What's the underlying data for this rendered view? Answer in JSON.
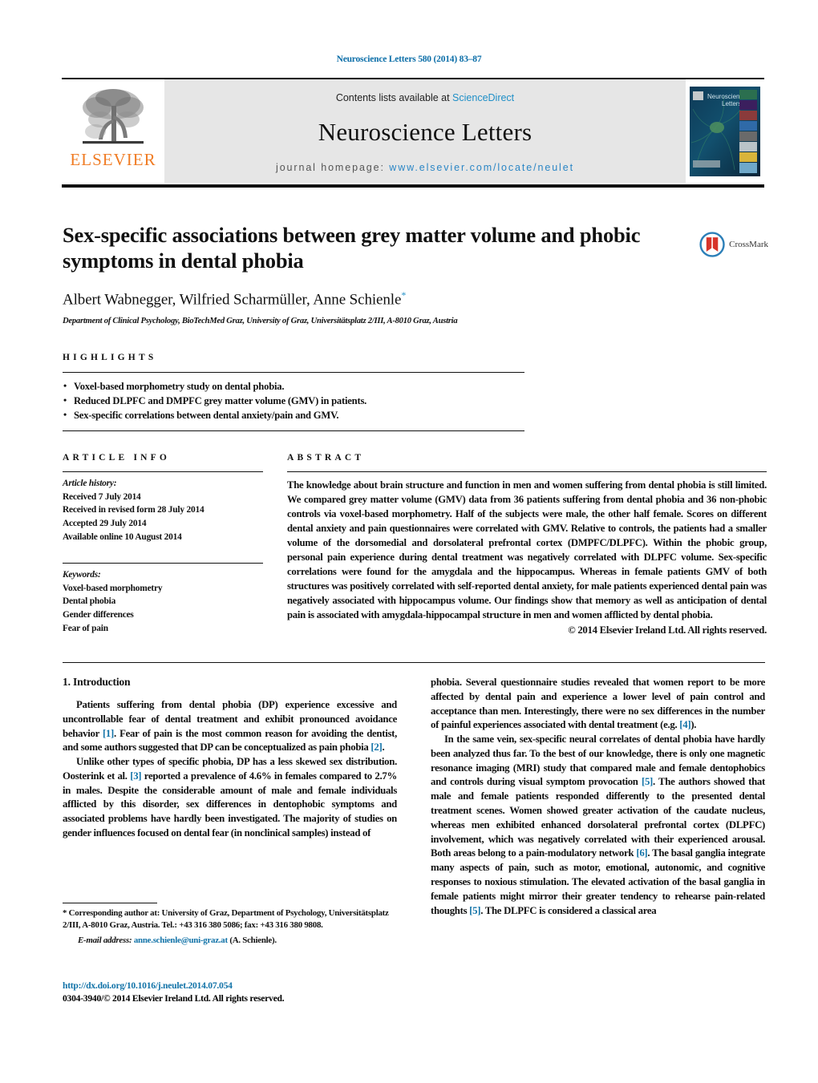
{
  "running_head": "Neuroscience Letters 580 (2014) 83–87",
  "masthead": {
    "contents_prefix": "Contents lists available at ",
    "sciencedirect": "ScienceDirect",
    "journal_title": "Neuroscience Letters",
    "homepage_label": "journal homepage:",
    "homepage_url": "www.elsevier.com/locate/neulet",
    "publisher_wordmark": "ELSEVIER",
    "publisher_color": "#f07c24",
    "link_color": "#1f8fc7",
    "cover_title_line1": "Neuroscience",
    "cover_title_line2": "Letters"
  },
  "article": {
    "title": "Sex-specific associations between grey matter volume and phobic symptoms in dental phobia",
    "authors": "Albert Wabnegger, Wilfried Scharmüller, Anne Schienle",
    "corresponding_marker": "*",
    "affiliation": "Department of Clinical Psychology, BioTechMed Graz, University of Graz, Universitätsplatz 2/III, A-8010 Graz, Austria",
    "crossmark_label": "CrossMark"
  },
  "highlights": {
    "heading": "HIGHLIGHTS",
    "items": [
      "Voxel-based morphometry study on dental phobia.",
      "Reduced DLPFC and DMPFC grey matter volume (GMV) in patients.",
      "Sex-specific correlations between dental anxiety/pain and GMV."
    ]
  },
  "article_info": {
    "heading": "ARTICLE INFO",
    "history_label": "Article history:",
    "history": [
      "Received 7 July 2014",
      "Received in revised form 28 July 2014",
      "Accepted 29 July 2014",
      "Available online 10 August 2014"
    ],
    "keywords_label": "Keywords:",
    "keywords": [
      "Voxel-based morphometry",
      "Dental phobia",
      "Gender differences",
      "Fear of pain"
    ]
  },
  "abstract": {
    "heading": "ABSTRACT",
    "text": "The knowledge about brain structure and function in men and women suffering from dental phobia is still limited. We compared grey matter volume (GMV) data from 36 patients suffering from dental phobia and 36 non-phobic controls via voxel-based morphometry. Half of the subjects were male, the other half female. Scores on different dental anxiety and pain questionnaires were correlated with GMV. Relative to controls, the patients had a smaller volume of the dorsomedial and dorsolateral prefrontal cortex (DMPFC/DLPFC). Within the phobic group, personal pain experience during dental treatment was negatively correlated with DLPFC volume. Sex-specific correlations were found for the amygdala and the hippocampus. Whereas in female patients GMV of both structures was positively correlated with self-reported dental anxiety, for male patients experienced dental pain was negatively associated with hippocampus volume. Our findings show that memory as well as anticipation of dental pain is associated with amygdala-hippocampal structure in men and women afflicted by dental phobia.",
    "copyright": "© 2014 Elsevier Ireland Ltd. All rights reserved."
  },
  "body": {
    "section_heading": "1.  Introduction",
    "left_paragraphs": [
      "Patients suffering from dental phobia (DP) experience excessive and uncontrollable fear of dental treatment and exhibit pronounced avoidance behavior [1]. Fear of pain is the most common reason for avoiding the dentist, and some authors suggested that DP can be conceptualized as pain phobia [2].",
      "Unlike other types of specific phobia, DP has a less skewed sex distribution. Oosterink et al. [3] reported a prevalence of 4.6% in females compared to 2.7% in males. Despite the considerable amount of male and female individuals afflicted by this disorder, sex differences in dentophobic symptoms and associated problems have hardly been investigated. The majority of studies on gender influences focused on dental fear (in nonclinical samples) instead of"
    ],
    "right_paragraphs": [
      "phobia. Several questionnaire studies revealed that women report to be more affected by dental pain and experience a lower level of pain control and acceptance than men. Interestingly, there were no sex differences in the number of painful experiences associated with dental treatment (e.g. [4]).",
      "In the same vein, sex-specific neural correlates of dental phobia have hardly been analyzed thus far. To the best of our knowledge, there is only one magnetic resonance imaging (MRI) study that compared male and female dentophobics and controls during visual symptom provocation [5]. The authors showed that male and female patients responded differently to the presented dental treatment scenes. Women showed greater activation of the caudate nucleus, whereas men exhibited enhanced dorsolateral prefrontal cortex (DLPFC) involvement, which was negatively correlated with their experienced arousal. Both areas belong to a pain-modulatory network [6]. The basal ganglia integrate many aspects of pain, such as motor, emotional, autonomic, and cognitive responses to noxious stimulation. The elevated activation of the basal ganglia in female patients might mirror their greater tendency to rehearse pain-related thoughts [5]. The DLPFC is considered a classical area"
    ]
  },
  "footnotes": {
    "corresponding": "* Corresponding author at: University of Graz, Department of Psychology, Universitätsplatz 2/III, A-8010 Graz, Austria. Tel.: +43 316 380 5086; fax: +43 316 380 9808.",
    "email_label": "E-mail address:",
    "email": "anne.schienle@uni-graz.at",
    "email_person": "(A. Schienle).",
    "doi_url": "http://dx.doi.org/10.1016/j.neulet.2014.07.054",
    "issn_line": "0304-3940/© 2014 Elsevier Ireland Ltd. All rights reserved."
  }
}
